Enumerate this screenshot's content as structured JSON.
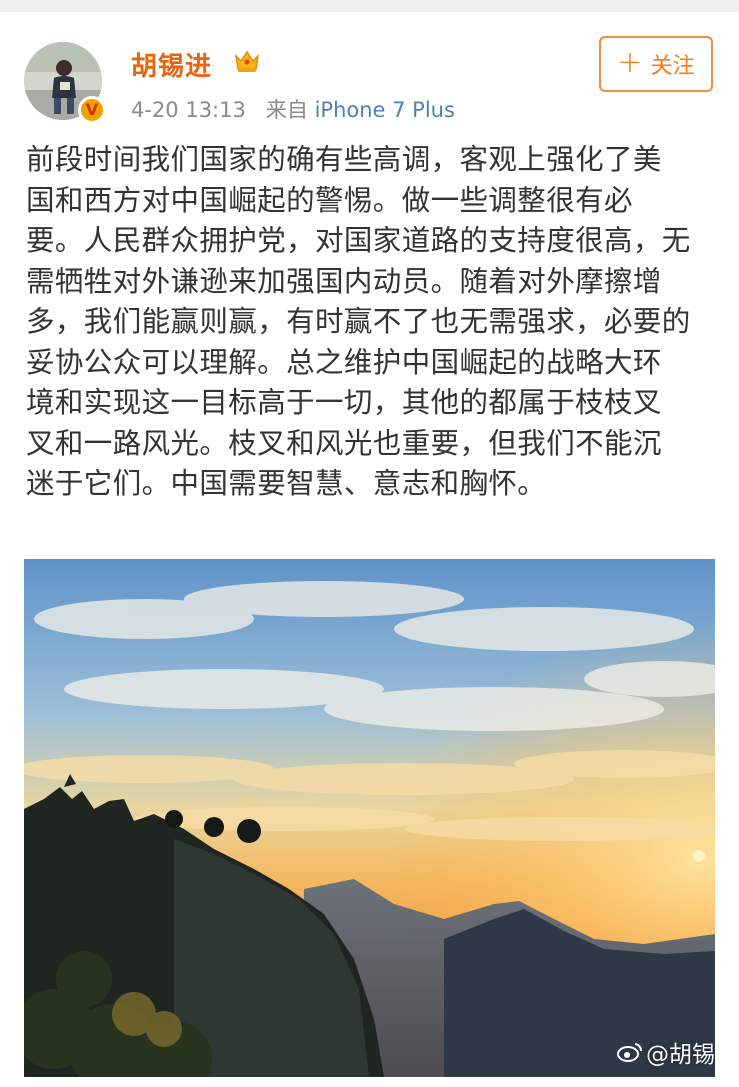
{
  "post": {
    "author": "胡锡进",
    "time": "4-20 13:13",
    "from_label": "来自",
    "device": "iPhone 7 Plus",
    "follow_label": "关注",
    "content_lines": [
      "前段时间我们国家的确有些高调，客观上强化了美",
      "国和西方对中国崛起的警惕。做一些调整很有必",
      "要。人民群众拥护党，对国家道路的支持度很高，无",
      "需牺牲对外谦逊来加强国内动员。随着对外摩擦增",
      "多，我们能赢则赢，有时赢不了也无需强求，必要的",
      "妥协公众可以理解。总之维护中国崛起的战略大环",
      "境和实现这一目标高于一切，其他的都属于枝枝叉",
      "叉和一路风光。枝叉和风光也重要，但我们不能沉",
      "迷于它们。中国需要智慧、意志和胸怀。"
    ],
    "watermark": "@胡锡"
  },
  "colors": {
    "username": "#e8650e",
    "device_link": "#4d7fbf",
    "follow_border": "#f08c3a",
    "verified_badge": "#f3a000",
    "text": "#333333",
    "meta": "#8a8a8a"
  },
  "icons": {
    "verified": "verified-badge-icon",
    "vip": "crown-icon",
    "follow": "plus-icon",
    "watermark": "weibo-logo-icon"
  }
}
